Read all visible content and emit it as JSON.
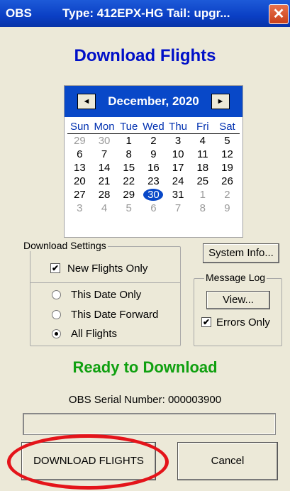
{
  "titlebar": {
    "app": "OBS",
    "title": "Type: 412EPX-HG   Tail: upgr..."
  },
  "heading": "Download Flights",
  "calendar": {
    "month_label": "December, 2020",
    "prev": "◄",
    "next": "►",
    "days_of_week": [
      "Sun",
      "Mon",
      "Tue",
      "Wed",
      "Thu",
      "Fri",
      "Sat"
    ],
    "weeks": [
      [
        "29",
        "30",
        "1",
        "2",
        "3",
        "4",
        "5"
      ],
      [
        "6",
        "7",
        "8",
        "9",
        "10",
        "11",
        "12"
      ],
      [
        "13",
        "14",
        "15",
        "16",
        "17",
        "18",
        "19"
      ],
      [
        "20",
        "21",
        "22",
        "23",
        "24",
        "25",
        "26"
      ],
      [
        "27",
        "28",
        "29",
        "30",
        "31",
        "1",
        "2"
      ],
      [
        "3",
        "4",
        "5",
        "6",
        "7",
        "8",
        "9"
      ]
    ],
    "selected_day": "30"
  },
  "download_settings": {
    "label": "Download Settings",
    "new_flights_only": "New Flights Only",
    "new_flights_checked": "✔",
    "this_date_only": "This Date Only",
    "this_date_forward": "This Date Forward",
    "all_flights": "All Flights"
  },
  "system_info_button": "System Info...",
  "message_log": {
    "label": "Message Log",
    "view_button": "View...",
    "errors_only": "Errors Only",
    "errors_checked": "✔"
  },
  "status": "Ready to Download",
  "serial": "OBS Serial Number: 000003900",
  "buttons": {
    "download": "DOWNLOAD FLIGHTS",
    "cancel": "Cancel"
  },
  "colors": {
    "titlebar": "#0a3fc4",
    "heading": "#0010c8",
    "status": "#10a010",
    "highlight": "#e4141a"
  }
}
